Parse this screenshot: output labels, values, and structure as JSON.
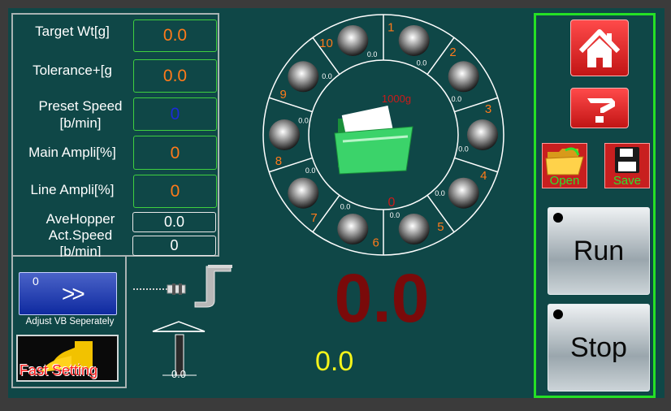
{
  "params": {
    "target_wt": {
      "label": "Target Wt[g]",
      "value": "0.0"
    },
    "tolerance": {
      "label": "Tolerance+[g",
      "value": "0.0"
    },
    "preset_speed": {
      "label1": "Preset Speed",
      "label2": "[b/min]",
      "value": "0"
    },
    "main_ampli": {
      "label": "Main Ampli[%]",
      "value": "0"
    },
    "line_ampli": {
      "label": "Line Ampli[%]",
      "value": "0"
    },
    "ave_hopper": {
      "label": "AveHopper",
      "value": "0.0"
    },
    "act_speed": {
      "label1": "Act.Speed",
      "label2": "[b/min]",
      "value": "0"
    }
  },
  "adjust": {
    "count": "0",
    "arrows": ">>",
    "label": "Adjust VB Seperately"
  },
  "fast_setting": {
    "label": "Fast Setting"
  },
  "dial": {
    "top_label": "1000g",
    "center_count": "0",
    "hoppers": [
      {
        "num": "1",
        "value": "0.0"
      },
      {
        "num": "2",
        "value": "0.0"
      },
      {
        "num": "3",
        "value": "0.0"
      },
      {
        "num": "4",
        "value": "0.0"
      },
      {
        "num": "5",
        "value": "0.0"
      },
      {
        "num": "6",
        "value": "0.0"
      },
      {
        "num": "7",
        "value": "0.0"
      },
      {
        "num": "8",
        "value": "0.0"
      },
      {
        "num": "9",
        "value": "0.0"
      },
      {
        "num": "10",
        "value": "0.0"
      }
    ]
  },
  "machine": {
    "value": "0.0"
  },
  "weight": {
    "main": "0.0",
    "sub": "0.0"
  },
  "right": {
    "open_label": "Open",
    "save_label": "Save",
    "run_label": "Run",
    "stop_label": "Stop"
  },
  "colors": {
    "background": "#0f4747",
    "accent_green": "#25e025",
    "value_orange": "#ff7a1a",
    "weight_red": "#7a0a0a"
  }
}
